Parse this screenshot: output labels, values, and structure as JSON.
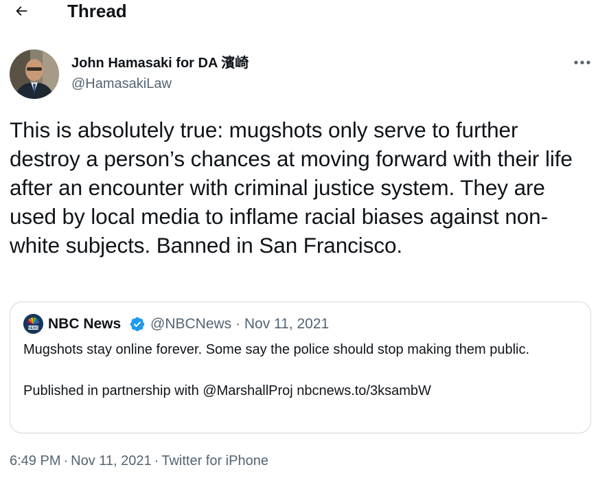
{
  "header": {
    "title": "Thread",
    "back_icon": "arrow-left-icon"
  },
  "tweet": {
    "author": {
      "name": "John Hamasaki for DA 濱崎",
      "handle": "@HamasakiLaw",
      "avatar_icon": "profile-photo"
    },
    "more_icon": "more-horizontal-icon",
    "text": "This is absolutely true: mugshots only serve to further destroy a person’s chances at moving forward with their life after an encounter with criminal justice system. They are used by local media to inflame racial biases against non-white subjects. Banned in San Francisco.",
    "quote": {
      "name": "NBC News",
      "verified_icon": "verified-badge-icon",
      "handle": "@NBCNews",
      "date": "Nov 11, 2021",
      "line1": "Mugshots stay online forever. Some say the police should stop making them public.",
      "line2": "Published in partnership with @MarshallProj nbcnews.to/3ksambW"
    },
    "meta": {
      "time": "6:49 PM",
      "date": "Nov 11, 2021",
      "source": "Twitter for iPhone",
      "separator": "·"
    }
  },
  "colors": {
    "text": "#0f1419",
    "secondary": "#536471",
    "border": "#cfd9de",
    "verified": "#1d9bf0"
  }
}
